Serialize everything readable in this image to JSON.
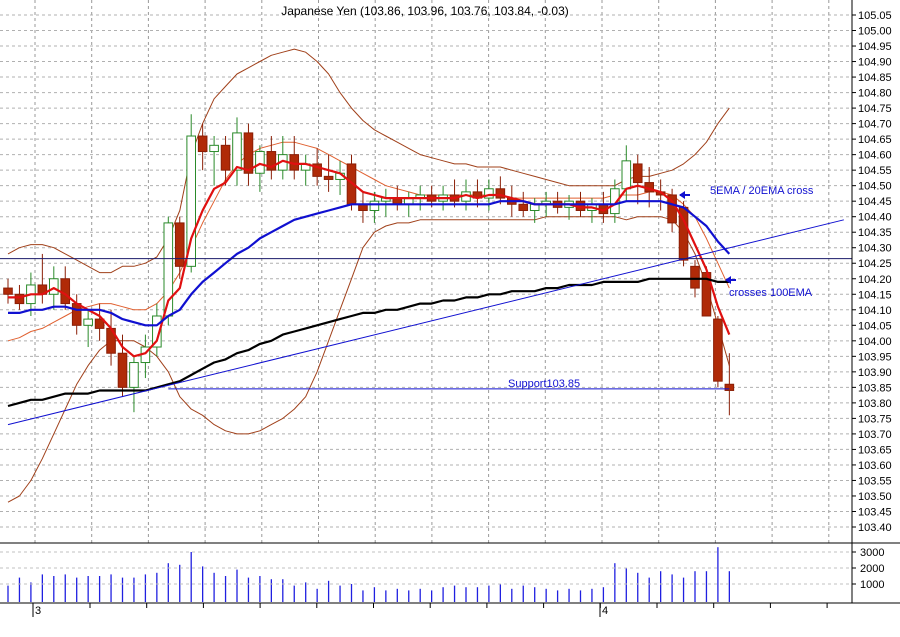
{
  "chart_data": [
    {
      "type": "candlestick",
      "title": "Japanese Yen (103.86, 103.96, 103.76, 103.84, -0.03)",
      "ylim": [
        103.35,
        105.07
      ],
      "y_tick_labels": [
        "105.05",
        "105.00",
        "104.95",
        "104.90",
        "104.85",
        "104.80",
        "104.75",
        "104.70",
        "104.65",
        "104.60",
        "104.55",
        "104.50",
        "104.45",
        "104.40",
        "104.35",
        "104.30",
        "104.25",
        "104.20",
        "104.15",
        "104.10",
        "104.05",
        "104.00",
        "103.95",
        "103.90",
        "103.85",
        "103.80",
        "103.75",
        "103.70",
        "103.65",
        "103.60",
        "103.55",
        "103.50",
        "103.45",
        "103.40"
      ],
      "x_tick_labels": [
        "3",
        "4"
      ],
      "grid": true,
      "candles": [
        {
          "o": 104.17,
          "h": 104.2,
          "l": 104.12,
          "c": 104.15
        },
        {
          "o": 104.15,
          "h": 104.18,
          "l": 104.1,
          "c": 104.12
        },
        {
          "o": 104.12,
          "h": 104.22,
          "l": 104.08,
          "c": 104.18
        },
        {
          "o": 104.18,
          "h": 104.28,
          "l": 104.12,
          "c": 104.15
        },
        {
          "o": 104.15,
          "h": 104.24,
          "l": 104.1,
          "c": 104.2
        },
        {
          "o": 104.2,
          "h": 104.24,
          "l": 104.1,
          "c": 104.12
        },
        {
          "o": 104.12,
          "h": 104.15,
          "l": 104.02,
          "c": 104.05
        },
        {
          "o": 104.05,
          "h": 104.1,
          "l": 103.98,
          "c": 104.07
        },
        {
          "o": 104.07,
          "h": 104.12,
          "l": 104.0,
          "c": 104.04
        },
        {
          "o": 104.04,
          "h": 104.1,
          "l": 103.92,
          "c": 103.96
        },
        {
          "o": 103.96,
          "h": 104.02,
          "l": 103.82,
          "c": 103.85
        },
        {
          "o": 103.85,
          "h": 103.95,
          "l": 103.77,
          "c": 103.93
        },
        {
          "o": 103.93,
          "h": 104.02,
          "l": 103.88,
          "c": 103.98
        },
        {
          "o": 103.98,
          "h": 104.12,
          "l": 103.95,
          "c": 104.08
        },
        {
          "o": 104.08,
          "h": 104.4,
          "l": 104.05,
          "c": 104.38
        },
        {
          "o": 104.38,
          "h": 104.4,
          "l": 104.2,
          "c": 104.24
        },
        {
          "o": 104.24,
          "h": 104.73,
          "l": 104.22,
          "c": 104.66
        },
        {
          "o": 104.66,
          "h": 104.7,
          "l": 104.55,
          "c": 104.61
        },
        {
          "o": 104.61,
          "h": 104.66,
          "l": 104.5,
          "c": 104.63
        },
        {
          "o": 104.63,
          "h": 104.66,
          "l": 104.5,
          "c": 104.55
        },
        {
          "o": 104.55,
          "h": 104.72,
          "l": 104.5,
          "c": 104.67
        },
        {
          "o": 104.67,
          "h": 104.7,
          "l": 104.5,
          "c": 104.54
        },
        {
          "o": 104.54,
          "h": 104.63,
          "l": 104.48,
          "c": 104.61
        },
        {
          "o": 104.61,
          "h": 104.66,
          "l": 104.52,
          "c": 104.55
        },
        {
          "o": 104.55,
          "h": 104.66,
          "l": 104.52,
          "c": 104.6
        },
        {
          "o": 104.6,
          "h": 104.66,
          "l": 104.52,
          "c": 104.55
        },
        {
          "o": 104.55,
          "h": 104.6,
          "l": 104.5,
          "c": 104.57
        },
        {
          "o": 104.57,
          "h": 104.62,
          "l": 104.5,
          "c": 104.53
        },
        {
          "o": 104.53,
          "h": 104.6,
          "l": 104.48,
          "c": 104.52
        },
        {
          "o": 104.52,
          "h": 104.58,
          "l": 104.47,
          "c": 104.54
        },
        {
          "o": 104.57,
          "h": 104.6,
          "l": 104.42,
          "c": 104.44
        },
        {
          "o": 104.44,
          "h": 104.48,
          "l": 104.38,
          "c": 104.42
        },
        {
          "o": 104.42,
          "h": 104.48,
          "l": 104.38,
          "c": 104.45
        },
        {
          "o": 104.45,
          "h": 104.49,
          "l": 104.4,
          "c": 104.46
        },
        {
          "o": 104.46,
          "h": 104.5,
          "l": 104.42,
          "c": 104.44
        },
        {
          "o": 104.44,
          "h": 104.48,
          "l": 104.4,
          "c": 104.46
        },
        {
          "o": 104.46,
          "h": 104.5,
          "l": 104.42,
          "c": 104.47
        },
        {
          "o": 104.47,
          "h": 104.5,
          "l": 104.43,
          "c": 104.45
        },
        {
          "o": 104.45,
          "h": 104.5,
          "l": 104.42,
          "c": 104.47
        },
        {
          "o": 104.47,
          "h": 104.52,
          "l": 104.43,
          "c": 104.45
        },
        {
          "o": 104.45,
          "h": 104.52,
          "l": 104.42,
          "c": 104.48
        },
        {
          "o": 104.48,
          "h": 104.52,
          "l": 104.43,
          "c": 104.46
        },
        {
          "o": 104.46,
          "h": 104.52,
          "l": 104.42,
          "c": 104.49
        },
        {
          "o": 104.49,
          "h": 104.53,
          "l": 104.44,
          "c": 104.46
        },
        {
          "o": 104.46,
          "h": 104.5,
          "l": 104.4,
          "c": 104.44
        },
        {
          "o": 104.44,
          "h": 104.48,
          "l": 104.4,
          "c": 104.42
        },
        {
          "o": 104.42,
          "h": 104.46,
          "l": 104.38,
          "c": 104.44
        },
        {
          "o": 104.44,
          "h": 104.48,
          "l": 104.4,
          "c": 104.45
        },
        {
          "o": 104.45,
          "h": 104.48,
          "l": 104.41,
          "c": 104.43
        },
        {
          "o": 104.43,
          "h": 104.47,
          "l": 104.39,
          "c": 104.45
        },
        {
          "o": 104.45,
          "h": 104.48,
          "l": 104.4,
          "c": 104.42
        },
        {
          "o": 104.42,
          "h": 104.46,
          "l": 104.38,
          "c": 104.44
        },
        {
          "o": 104.44,
          "h": 104.48,
          "l": 104.38,
          "c": 104.41
        },
        {
          "o": 104.41,
          "h": 104.52,
          "l": 104.38,
          "c": 104.49
        },
        {
          "o": 104.49,
          "h": 104.63,
          "l": 104.45,
          "c": 104.58
        },
        {
          "o": 104.57,
          "h": 104.6,
          "l": 104.44,
          "c": 104.51
        },
        {
          "o": 104.51,
          "h": 104.56,
          "l": 104.43,
          "c": 104.48
        },
        {
          "o": 104.48,
          "h": 104.52,
          "l": 104.42,
          "c": 104.47
        },
        {
          "o": 104.47,
          "h": 104.49,
          "l": 104.35,
          "c": 104.38
        },
        {
          "o": 104.43,
          "h": 104.45,
          "l": 104.24,
          "c": 104.26
        },
        {
          "o": 104.24,
          "h": 104.26,
          "l": 104.14,
          "c": 104.17
        },
        {
          "o": 104.22,
          "h": 104.24,
          "l": 104.08,
          "c": 104.08
        },
        {
          "o": 104.07,
          "h": 104.08,
          "l": 103.85,
          "c": 103.87
        },
        {
          "o": 103.86,
          "h": 103.96,
          "l": 103.76,
          "c": 103.84
        }
      ],
      "series": [
        {
          "name": "5EMA",
          "color": "#e01010",
          "values": [
            104.14,
            104.14,
            104.15,
            104.15,
            104.17,
            104.15,
            104.12,
            104.1,
            104.08,
            104.04,
            103.98,
            103.95,
            103.96,
            104.0,
            104.13,
            104.17,
            104.33,
            104.42,
            104.49,
            104.51,
            104.56,
            104.55,
            104.57,
            104.56,
            104.58,
            104.57,
            104.57,
            104.56,
            104.55,
            104.54,
            104.51,
            104.48,
            104.47,
            104.46,
            104.46,
            104.46,
            104.46,
            104.46,
            104.46,
            104.46,
            104.47,
            104.46,
            104.47,
            104.47,
            104.46,
            104.45,
            104.44,
            104.44,
            104.44,
            104.44,
            104.43,
            104.43,
            104.42,
            104.44,
            104.49,
            104.5,
            104.49,
            104.48,
            104.45,
            104.39,
            104.31,
            104.23,
            104.11,
            104.02
          ]
        },
        {
          "name": "20EMA",
          "color": "#1010d0",
          "values": [
            104.09,
            104.09,
            104.1,
            104.1,
            104.11,
            104.11,
            104.1,
            104.1,
            104.1,
            104.09,
            104.07,
            104.06,
            104.05,
            104.05,
            104.08,
            104.1,
            104.15,
            104.19,
            104.22,
            104.25,
            104.28,
            104.3,
            104.33,
            104.35,
            104.37,
            104.39,
            104.4,
            104.41,
            104.42,
            104.43,
            104.44,
            104.44,
            104.44,
            104.44,
            104.44,
            104.44,
            104.44,
            104.44,
            104.44,
            104.44,
            104.44,
            104.44,
            104.44,
            104.45,
            104.45,
            104.45,
            104.44,
            104.44,
            104.44,
            104.44,
            104.44,
            104.44,
            104.44,
            104.44,
            104.45,
            104.45,
            104.45,
            104.45,
            104.44,
            104.43,
            104.4,
            104.37,
            104.32,
            104.28
          ]
        },
        {
          "name": "100EMA",
          "color": "#000000",
          "values": [
            103.79,
            103.8,
            103.81,
            103.81,
            103.82,
            103.83,
            103.83,
            103.83,
            103.84,
            103.84,
            103.84,
            103.84,
            103.84,
            103.85,
            103.86,
            103.87,
            103.89,
            103.91,
            103.93,
            103.94,
            103.96,
            103.97,
            103.99,
            104.0,
            104.02,
            104.03,
            104.04,
            104.05,
            104.06,
            104.07,
            104.08,
            104.09,
            104.09,
            104.1,
            104.1,
            104.11,
            104.12,
            104.12,
            104.13,
            104.13,
            104.14,
            104.14,
            104.15,
            104.15,
            104.16,
            104.16,
            104.16,
            104.17,
            104.17,
            104.18,
            104.18,
            104.18,
            104.19,
            104.19,
            104.19,
            104.19,
            104.2,
            104.2,
            104.2,
            104.2,
            104.2,
            104.2,
            104.19,
            104.19
          ]
        },
        {
          "name": "Bollinger upper",
          "color": "#a0401a",
          "values": [
            104.28,
            104.3,
            104.31,
            104.31,
            104.3,
            104.28,
            104.26,
            104.24,
            104.22,
            104.22,
            104.24,
            104.24,
            104.25,
            104.27,
            104.33,
            104.42,
            104.6,
            104.7,
            104.78,
            104.82,
            104.86,
            104.88,
            104.9,
            104.92,
            104.93,
            104.94,
            104.93,
            104.9,
            104.86,
            104.8,
            104.75,
            104.71,
            104.68,
            104.66,
            104.64,
            104.62,
            104.6,
            104.59,
            104.58,
            104.57,
            104.57,
            104.56,
            104.56,
            104.56,
            104.55,
            104.54,
            104.53,
            104.52,
            104.51,
            104.5,
            104.5,
            104.5,
            104.5,
            104.5,
            104.52,
            104.53,
            104.53,
            104.54,
            104.55,
            104.57,
            104.6,
            104.64,
            104.7,
            104.75
          ]
        },
        {
          "name": "Bollinger middle",
          "color": "#e06030",
          "values": [
            104.0,
            104.01,
            104.03,
            104.04,
            104.06,
            104.08,
            104.1,
            104.11,
            104.12,
            104.12,
            104.11,
            104.1,
            104.1,
            104.12,
            104.16,
            104.22,
            104.3,
            104.38,
            104.45,
            104.52,
            104.57,
            104.6,
            104.62,
            104.63,
            104.64,
            104.64,
            104.63,
            104.62,
            104.6,
            104.58,
            104.56,
            104.54,
            104.52,
            104.5,
            104.49,
            104.48,
            104.47,
            104.47,
            104.47,
            104.47,
            104.47,
            104.47,
            104.47,
            104.47,
            104.46,
            104.46,
            104.46,
            104.46,
            104.46,
            104.46,
            104.46,
            104.46,
            104.46,
            104.47,
            104.47,
            104.47,
            104.48,
            104.48,
            104.47,
            104.44,
            104.4,
            104.33,
            104.25,
            104.17
          ]
        },
        {
          "name": "Bollinger lower",
          "color": "#a0401a",
          "values": [
            103.48,
            103.5,
            103.55,
            103.62,
            103.7,
            103.78,
            103.86,
            103.92,
            103.97,
            104.0,
            104.0,
            104.0,
            103.98,
            103.95,
            103.9,
            103.82,
            103.78,
            103.76,
            103.73,
            103.71,
            103.7,
            103.7,
            103.71,
            103.73,
            103.75,
            103.78,
            103.82,
            103.9,
            104.0,
            104.1,
            104.2,
            104.3,
            104.35,
            104.37,
            104.38,
            104.38,
            104.39,
            104.39,
            104.39,
            104.39,
            104.39,
            104.39,
            104.39,
            104.39,
            104.39,
            104.39,
            104.39,
            104.4,
            104.4,
            104.4,
            104.4,
            104.4,
            104.4,
            104.4,
            104.39,
            104.4,
            104.4,
            104.4,
            104.39,
            104.35,
            104.28,
            104.18,
            104.05,
            103.92
          ]
        }
      ],
      "trendline": {
        "from": [
          0,
          103.73
        ],
        "to": [
          73,
          104.39
        ],
        "color": "#1010d0"
      },
      "hlines": [
        {
          "value": 104.265,
          "color": "#1a1a6a"
        },
        {
          "value": 103.845,
          "start": 14,
          "end": 63,
          "color": "#1010d0"
        }
      ],
      "annotations": [
        {
          "text": "5EMA / 20EMA cross",
          "arrow": "left",
          "color": "#1010d0"
        },
        {
          "text": "crosses 100EMA",
          "arrow": "left",
          "color": "#1010d0"
        },
        {
          "text": "Support103.85",
          "color": "#1010d0"
        }
      ]
    },
    {
      "type": "bar",
      "ylim": [
        0,
        3600
      ],
      "y_tick_labels": [
        "3000",
        "2000",
        "1000"
      ],
      "series": [
        {
          "color": "#2020e0",
          "values": [
            900,
            1400,
            1100,
            1600,
            1500,
            1600,
            1400,
            1500,
            1500,
            1600,
            1400,
            1400,
            1600,
            1700,
            2300,
            2200,
            3000,
            2100,
            1700,
            1500,
            1900,
            1400,
            1500,
            1300,
            1300,
            900,
            1100,
            700,
            1200,
            900,
            1000,
            600,
            800,
            600,
            700,
            600,
            700,
            600,
            800,
            900,
            800,
            800,
            900,
            1000,
            700,
            900,
            800,
            700,
            600,
            700,
            600,
            700,
            800,
            2300,
            2000,
            1700,
            1400,
            1800,
            1600,
            1400,
            1800,
            1800,
            3300,
            1800
          ]
        }
      ]
    }
  ]
}
